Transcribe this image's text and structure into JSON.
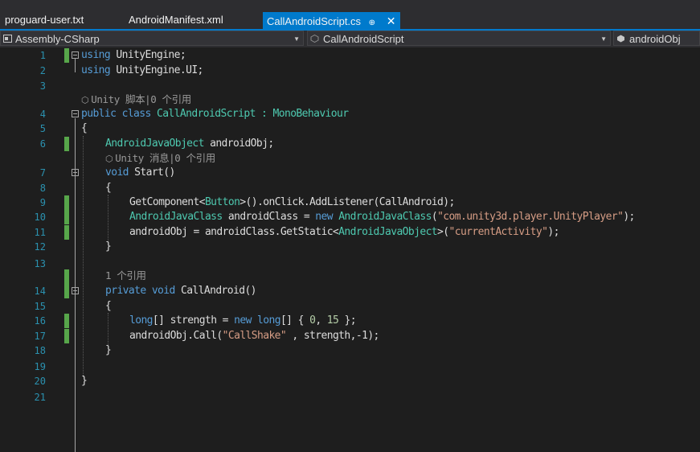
{
  "tabs": [
    {
      "label": "proguard-user.txt",
      "active": false
    },
    {
      "label": "AndroidManifest.xml",
      "active": false
    },
    {
      "label": "CallAndroidScript.cs",
      "active": true,
      "pin": "⊕",
      "close": "✕"
    }
  ],
  "navbar": {
    "project": "Assembly-CSharp",
    "class": "CallAndroidScript",
    "member": "androidObj",
    "arrow": "▼"
  },
  "lens": {
    "class_refs": "Unity 脚本|0 个引用",
    "start_refs": "Unity 消息|0 个引用",
    "callandroid_refs": "1 个引用",
    "cube": "⬡"
  },
  "lines": {
    "n1": "1",
    "n2": "2",
    "n3": "3",
    "n4": "4",
    "n5": "5",
    "n6": "6",
    "n7": "7",
    "n8": "8",
    "n9": "9",
    "n10": "10",
    "n11": "11",
    "n12": "12",
    "n13": "13",
    "n14": "14",
    "n15": "15",
    "n16": "16",
    "n17": "17",
    "n18": "18",
    "n19": "19",
    "n20": "20",
    "n21": "21"
  },
  "code": {
    "l1": {
      "kw": "using",
      "rest": " UnityEngine;"
    },
    "l2": {
      "kw": "using",
      "rest": " UnityEngine.UI;"
    },
    "l4": {
      "kw1": "public",
      "kw2": " class",
      "name": " CallAndroidScript : ",
      "base": "MonoBehaviour"
    },
    "l5": {
      "text": "{"
    },
    "l6": {
      "type": "AndroidJavaObject",
      "rest": " androidObj;"
    },
    "l7": {
      "kw": "void",
      "rest": " Start()"
    },
    "l8": {
      "text": "{"
    },
    "l9": {
      "a": "GetComponent<",
      "type": "Button",
      "b": ">().onClick.AddListener(CallAndroid);"
    },
    "l10": {
      "type1": "AndroidJavaClass",
      "a": " androidClass = ",
      "kw": "new",
      "type2": " AndroidJavaClass",
      "b": "(",
      "str": "\"com.unity3d.player.UnityPlayer\"",
      "c": ");"
    },
    "l11": {
      "a": "androidObj = androidClass.GetStatic<",
      "type": "AndroidJavaObject",
      "b": ">(",
      "str": "\"currentActivity\"",
      "c": ");"
    },
    "l12": {
      "text": "}"
    },
    "l14": {
      "kw1": "private",
      "kw2": " void",
      "rest": " CallAndroid()"
    },
    "l15": {
      "text": "{"
    },
    "l16": {
      "kw1": "long",
      "a": "[] strength = ",
      "kw2": "new",
      "kw3": " long",
      "b": "[] { ",
      "n1": "0",
      "c": ", ",
      "n2": "15",
      "d": " };"
    },
    "l17": {
      "a": "androidObj.Call(",
      "str": "\"CallShake\"",
      "b": " , strength,-1);"
    },
    "l18": {
      "text": "}"
    },
    "l20": {
      "text": "}"
    }
  },
  "colors": {
    "accent": "#007acc",
    "keyword": "#569cd6",
    "type": "#4ec9b0",
    "string": "#d69d85",
    "number": "#b5cea8",
    "line_number": "#2b91af",
    "change_bar": "#57a64a"
  }
}
